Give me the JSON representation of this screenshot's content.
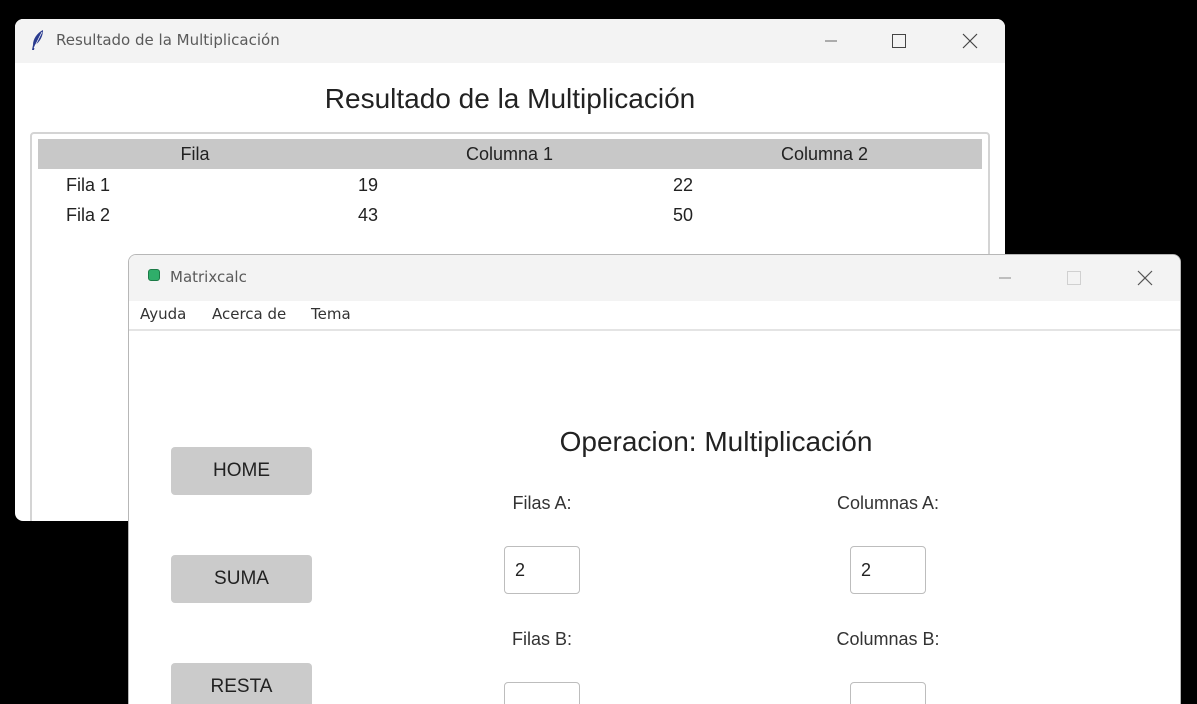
{
  "result_window": {
    "title": "Resultado de la Multiplicación",
    "heading": "Resultado de la Multiplicación",
    "table": {
      "headers": [
        "Fila",
        "Columna 1",
        "Columna 2"
      ],
      "rows": [
        [
          "Fila 1",
          "19",
          "22"
        ],
        [
          "Fila 2",
          "43",
          "50"
        ]
      ]
    }
  },
  "matrix_window": {
    "title": "Matrixcalc",
    "menu": [
      "Ayuda",
      "Acerca de",
      "Tema"
    ],
    "nav_buttons": [
      "HOME",
      "SUMA",
      "RESTA"
    ],
    "operation_title": "Operacion: Multiplicación",
    "fields": {
      "filas_a": {
        "label": "Filas A:",
        "value": "2"
      },
      "columnas_a": {
        "label": "Columnas A:",
        "value": "2"
      },
      "filas_b": {
        "label": "Filas B:",
        "value": ""
      },
      "columnas_b": {
        "label": "Columnas B:",
        "value": ""
      }
    }
  }
}
